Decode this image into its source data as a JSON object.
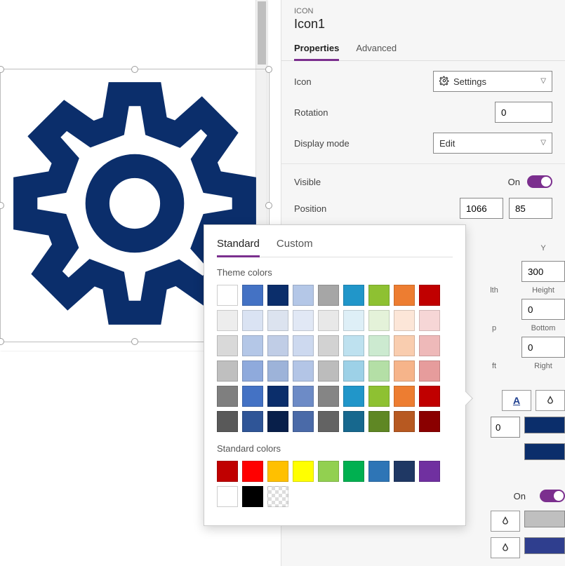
{
  "panel": {
    "type_label": "ICON",
    "name": "Icon1",
    "tabs": {
      "properties": "Properties",
      "advanced": "Advanced"
    },
    "rows": {
      "icon_label": "Icon",
      "icon_value": "Settings",
      "rotation_label": "Rotation",
      "rotation_value": "0",
      "display_mode_label": "Display mode",
      "display_mode_value": "Edit",
      "visible_label": "Visible",
      "visible_state": "On",
      "position_label": "Position",
      "position_x": "1066",
      "position_y": "85",
      "axis_y": "Y",
      "size_h": "300",
      "size_width_label": "lth",
      "size_height_label": "Height",
      "pad_top": "0",
      "pad_top_label": "p",
      "pad_bottom_label": "Bottom",
      "pad_right": "0",
      "pad_left_label": "ft",
      "pad_right_label": "Right",
      "border_val": "0",
      "toggle2_state": "On"
    }
  },
  "popup": {
    "tabs": {
      "standard": "Standard",
      "custom": "Custom"
    },
    "theme_label": "Theme colors",
    "standard_label": "Standard colors",
    "theme_colors_rows": [
      [
        "#ffffff",
        "#4472c4",
        "#0b2e6b",
        "#b4c7e7",
        "#a6a6a6",
        "#2196c9",
        "#8ec132",
        "#ed7d31",
        "#c00000"
      ],
      [
        "#ededed",
        "#dae3f3",
        "#dce3ef",
        "#e1e8f5",
        "#e8e8e8",
        "#deeff7",
        "#e4f2d9",
        "#fce6d8",
        "#f6d6d6"
      ],
      [
        "#d9d9d9",
        "#b4c7e7",
        "#c0cde6",
        "#cdd9ef",
        "#d2d2d2",
        "#bee1ef",
        "#ccead0",
        "#f9cdaf",
        "#eeb9b9"
      ],
      [
        "#bfbfbf",
        "#8faadc",
        "#9db3d9",
        "#b3c5e6",
        "#bcbcbc",
        "#9dd1e7",
        "#b4dfa6",
        "#f6b48a",
        "#e69c9c"
      ],
      [
        "#7f7f7f",
        "#4472c4",
        "#0b2e6b",
        "#6d8bc6",
        "#858585",
        "#2196c9",
        "#8ec132",
        "#ed7d31",
        "#c00000"
      ],
      [
        "#595959",
        "#2f5597",
        "#081f4a",
        "#4a6aa8",
        "#636363",
        "#17688e",
        "#5f8724",
        "#b75921",
        "#8a0000"
      ]
    ],
    "standard_colors_row1": [
      "#c00000",
      "#ff0000",
      "#ffc000",
      "#ffff00",
      "#92d050",
      "#00b050",
      "#2e75b6",
      "#1f3864",
      "#7030a0"
    ],
    "standard_colors_row2": [
      "#ffffff",
      "#000000",
      "trans"
    ]
  },
  "colors": {
    "gear": "#0b2e6b",
    "swatch1": "#0b2e6b",
    "swatch2": "#0b2e6b",
    "swatch_grey": "#bfbfbf",
    "swatch_navy2": "#2f3e8e"
  }
}
